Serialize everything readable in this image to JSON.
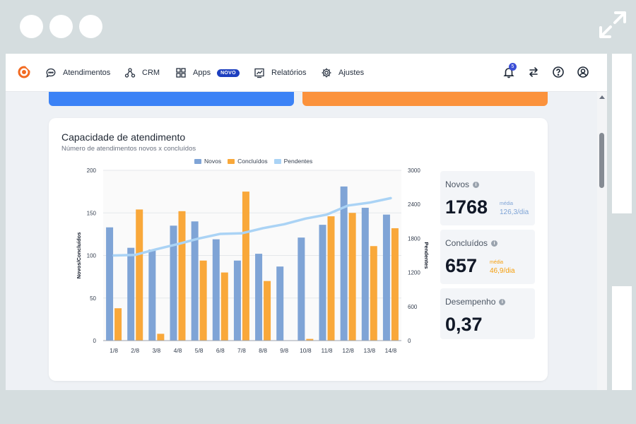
{
  "nav": {
    "items": [
      {
        "label": "Atendimentos",
        "icon": "chat-bubble-icon"
      },
      {
        "label": "CRM",
        "icon": "nodes-icon"
      },
      {
        "label": "Apps",
        "icon": "grid-icon",
        "badge": "NOVO"
      },
      {
        "label": "Relatórios",
        "icon": "chart-icon"
      },
      {
        "label": "Ajustes",
        "icon": "gear-icon"
      }
    ],
    "notifications_count": "5",
    "right_icons": [
      "bell-icon",
      "swap-arrows-icon",
      "help-icon",
      "user-icon"
    ]
  },
  "card": {
    "title": "Capacidade de atendimento",
    "subtitle": "Número de atendimentos novos x concluídos"
  },
  "stats": {
    "novos": {
      "label": "Novos",
      "value": "1768",
      "avg_label": "média",
      "avg_value": "126,3/dia"
    },
    "concluidos": {
      "label": "Concluídos",
      "value": "657",
      "avg_label": "média",
      "avg_value": "46,9/dia"
    },
    "desempenho": {
      "label": "Desempenho",
      "value": "0,37"
    }
  },
  "colors": {
    "novos": "#7fa4d6",
    "concluidos": "#f9a83a",
    "pendentes": "#aad3f5",
    "avg_novos": "#7fa4d6",
    "avg_concluidos": "#f59e0b"
  },
  "chart_data": {
    "type": "bar",
    "categories": [
      "1/8",
      "2/8",
      "3/8",
      "4/8",
      "5/8",
      "6/8",
      "7/8",
      "8/8",
      "9/8",
      "10/8",
      "11/8",
      "12/8",
      "13/8",
      "14/8"
    ],
    "series": [
      {
        "name": "Novos",
        "type": "bar",
        "axis": "left",
        "values": [
          133,
          109,
          107,
          135,
          140,
          119,
          94,
          102,
          87,
          121,
          136,
          181,
          156,
          148
        ]
      },
      {
        "name": "Concluídos",
        "type": "bar",
        "axis": "left",
        "values": [
          38,
          154,
          8,
          152,
          94,
          80,
          175,
          70,
          0,
          2,
          146,
          150,
          111,
          132
        ]
      },
      {
        "name": "Pendentes",
        "type": "line",
        "axis": "right",
        "values": [
          1500,
          1510,
          1610,
          1700,
          1800,
          1880,
          1890,
          1980,
          2050,
          2150,
          2220,
          2380,
          2430,
          2510
        ]
      }
    ],
    "ylabel": "Novos/Concluídos",
    "ylabel_right": "Pendentes",
    "ylim": [
      0,
      200
    ],
    "ylim_right": [
      0,
      3000
    ],
    "yticks": [
      0,
      50,
      100,
      150,
      200
    ],
    "yticks_right": [
      0,
      600,
      1200,
      1800,
      2400,
      3000
    ],
    "grid": true,
    "legend": "top"
  }
}
